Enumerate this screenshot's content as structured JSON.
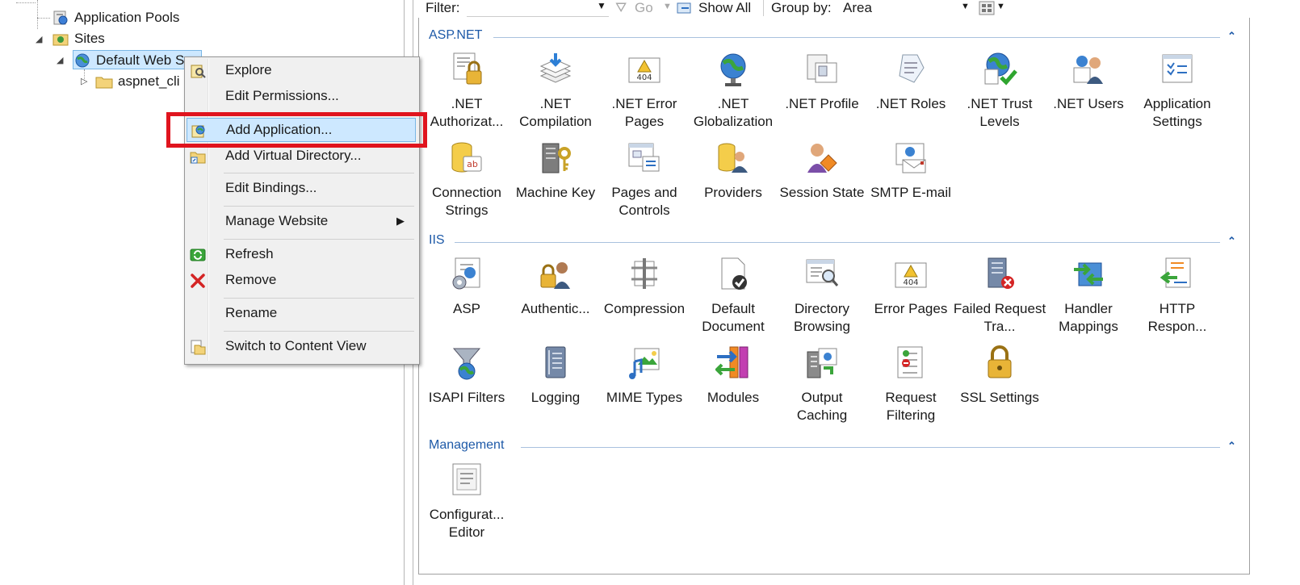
{
  "tree": {
    "items": [
      {
        "label": "Application Pools"
      },
      {
        "label": "Sites"
      },
      {
        "label": "Default Web S"
      },
      {
        "label": "aspnet_cli"
      }
    ]
  },
  "toolbar": {
    "filter_label": "Filter:",
    "go_label": "Go",
    "show_all_label": "Show All",
    "group_by_label": "Group by:",
    "group_by_value": "Area"
  },
  "sections": [
    {
      "title": "ASP.NET"
    },
    {
      "title": "IIS"
    },
    {
      "title": "Management"
    }
  ],
  "aspnet_features": [
    {
      "label": ".NET Authorizat...",
      "icon": "lock-doc-icon"
    },
    {
      "label": ".NET Compilation",
      "icon": "compile-stack-icon"
    },
    {
      "label": ".NET Error Pages",
      "icon": "error-404-icon"
    },
    {
      "label": ".NET Globalization",
      "icon": "globe-icon"
    },
    {
      "label": ".NET Profile",
      "icon": "profile-icon"
    },
    {
      "label": ".NET Roles",
      "icon": "roles-icon"
    },
    {
      "label": ".NET Trust Levels",
      "icon": "trust-globe-icon"
    },
    {
      "label": ".NET Users",
      "icon": "users-icon"
    },
    {
      "label": "Application Settings",
      "icon": "settings-list-icon"
    },
    {
      "label": "Connection Strings",
      "icon": "database-icon"
    },
    {
      "label": "Machine Key",
      "icon": "server-key-icon"
    },
    {
      "label": "Pages and Controls",
      "icon": "pages-icon"
    },
    {
      "label": "Providers",
      "icon": "providers-icon"
    },
    {
      "label": "Session State",
      "icon": "session-icon"
    },
    {
      "label": "SMTP E-mail",
      "icon": "email-icon"
    }
  ],
  "iis_features": [
    {
      "label": "ASP",
      "icon": "asp-icon"
    },
    {
      "label": "Authentic...",
      "icon": "auth-icon"
    },
    {
      "label": "Compression",
      "icon": "compression-icon"
    },
    {
      "label": "Default Document",
      "icon": "default-doc-icon"
    },
    {
      "label": "Directory Browsing",
      "icon": "dir-browse-icon"
    },
    {
      "label": "Error Pages",
      "icon": "error-404-icon"
    },
    {
      "label": "Failed Request Tra...",
      "icon": "failed-request-icon"
    },
    {
      "label": "Handler Mappings",
      "icon": "handler-icon"
    },
    {
      "label": "HTTP Respon...",
      "icon": "http-response-icon"
    },
    {
      "label": "ISAPI Filters",
      "icon": "funnel-globe-icon"
    },
    {
      "label": "Logging",
      "icon": "log-icon"
    },
    {
      "label": "MIME Types",
      "icon": "mime-icon"
    },
    {
      "label": "Modules",
      "icon": "modules-icon"
    },
    {
      "label": "Output Caching",
      "icon": "output-cache-icon"
    },
    {
      "label": "Request Filtering",
      "icon": "request-filter-icon"
    },
    {
      "label": "SSL Settings",
      "icon": "padlock-icon"
    }
  ],
  "management_features": [
    {
      "label": "Configurat... Editor",
      "icon": "config-editor-icon"
    }
  ],
  "context_menu": {
    "items": [
      {
        "label": "Explore"
      },
      {
        "label": "Edit Permissions..."
      },
      {
        "label": "Add Application..."
      },
      {
        "label": "Add Virtual Directory..."
      },
      {
        "label": "Edit Bindings..."
      },
      {
        "label": "Manage Website"
      },
      {
        "label": "Refresh"
      },
      {
        "label": "Remove"
      },
      {
        "label": "Rename"
      },
      {
        "label": "Switch to Content View"
      }
    ]
  },
  "colors": {
    "highlight_box": "#e0141e",
    "section_title": "#1e5aa8",
    "menu_hover": "#cde8ff"
  }
}
